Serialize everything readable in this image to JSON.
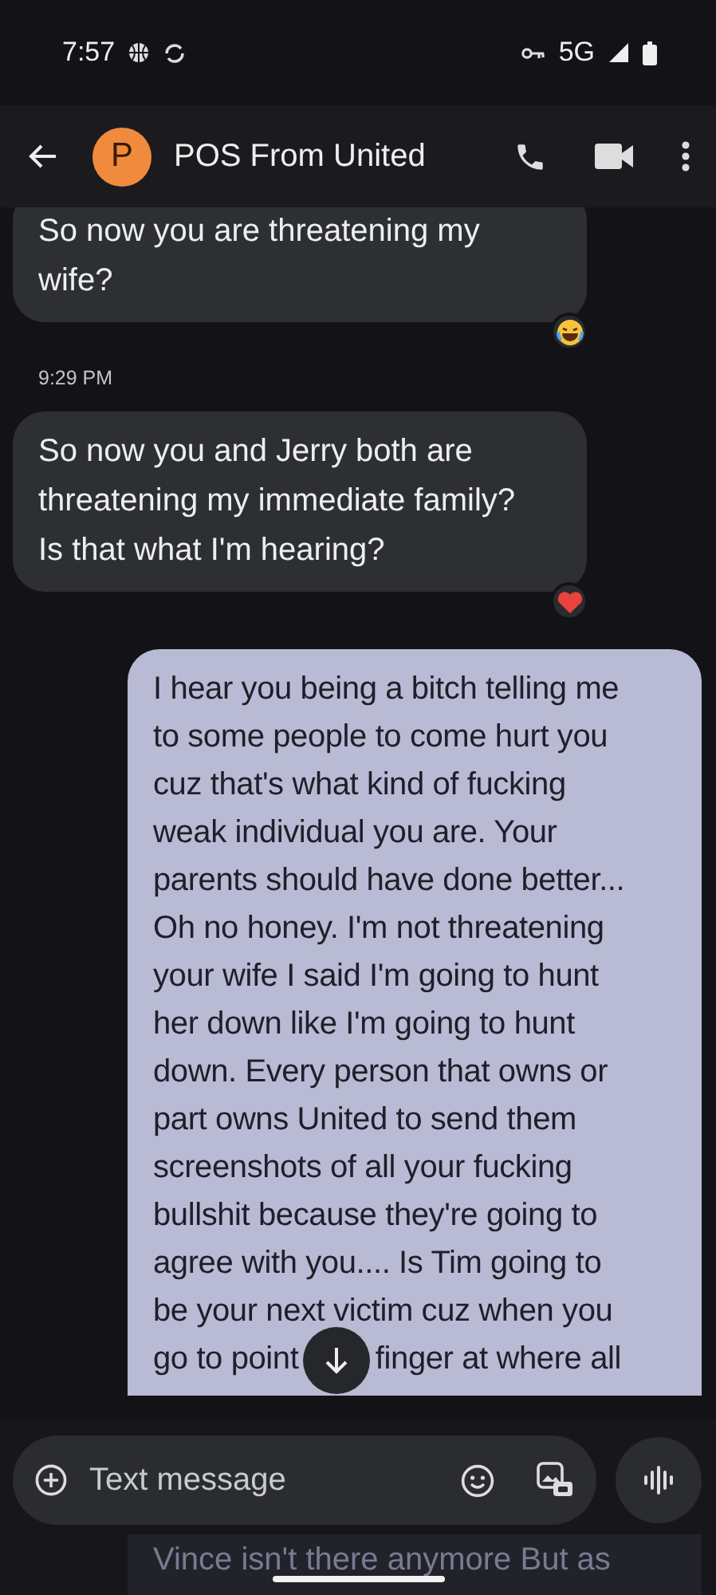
{
  "status_bar": {
    "time": "7:57",
    "network": "5G"
  },
  "header": {
    "avatar_letter": "P",
    "contact": "POS From United"
  },
  "messages": [
    {
      "kind": "incoming",
      "text": "So now you are threatening my\nwife?",
      "reaction": {
        "kind": "laughing"
      }
    },
    {
      "kind": "timestamp",
      "text": "9:29 PM"
    },
    {
      "kind": "incoming",
      "text": "So now you and Jerry both are\nthreatening my immediate family?\nIs that what I'm hearing?",
      "reaction": {
        "kind": "heart"
      }
    },
    {
      "kind": "outgoing",
      "text": "I hear you being a bitch telling me\nto some people to come hurt you\ncuz that's what kind of fucking\nweak individual you are. Your\nparents should have done better...\nOh no honey. I'm not threatening\nyour wife I said I'm going to hunt\nher down like I'm going to hunt\ndown. Every person that owns or\npart owns United to send them\nscreenshots of all your fucking\nbullshit because they're going to\nagree with you.... Is Tim going to\nbe your next victim cuz when you\ngo to point         finger at where all"
    }
  ],
  "compose": {
    "placeholder": "Text message"
  },
  "hidden_line": "Vince isn't there anymore But as"
}
